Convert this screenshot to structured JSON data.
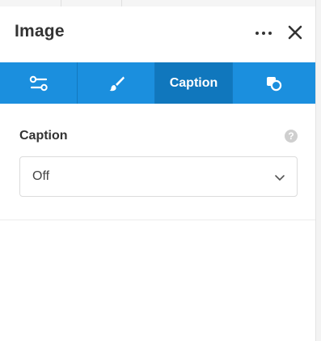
{
  "panel": {
    "title": "Image"
  },
  "tabs": [
    {
      "id": "general",
      "label": "",
      "icon": "sliders-icon",
      "active": false
    },
    {
      "id": "style",
      "label": "",
      "icon": "brush-icon",
      "active": false
    },
    {
      "id": "caption",
      "label": "Caption",
      "icon": "",
      "active": true
    },
    {
      "id": "advanced",
      "label": "",
      "icon": "shapes-icon",
      "active": false
    }
  ],
  "caption_section": {
    "label": "Caption",
    "help_icon": "?",
    "select": {
      "value": "Off"
    }
  },
  "colors": {
    "tab_bar": "#1b8fde",
    "tab_active": "#1077bd",
    "text": "#333333"
  }
}
